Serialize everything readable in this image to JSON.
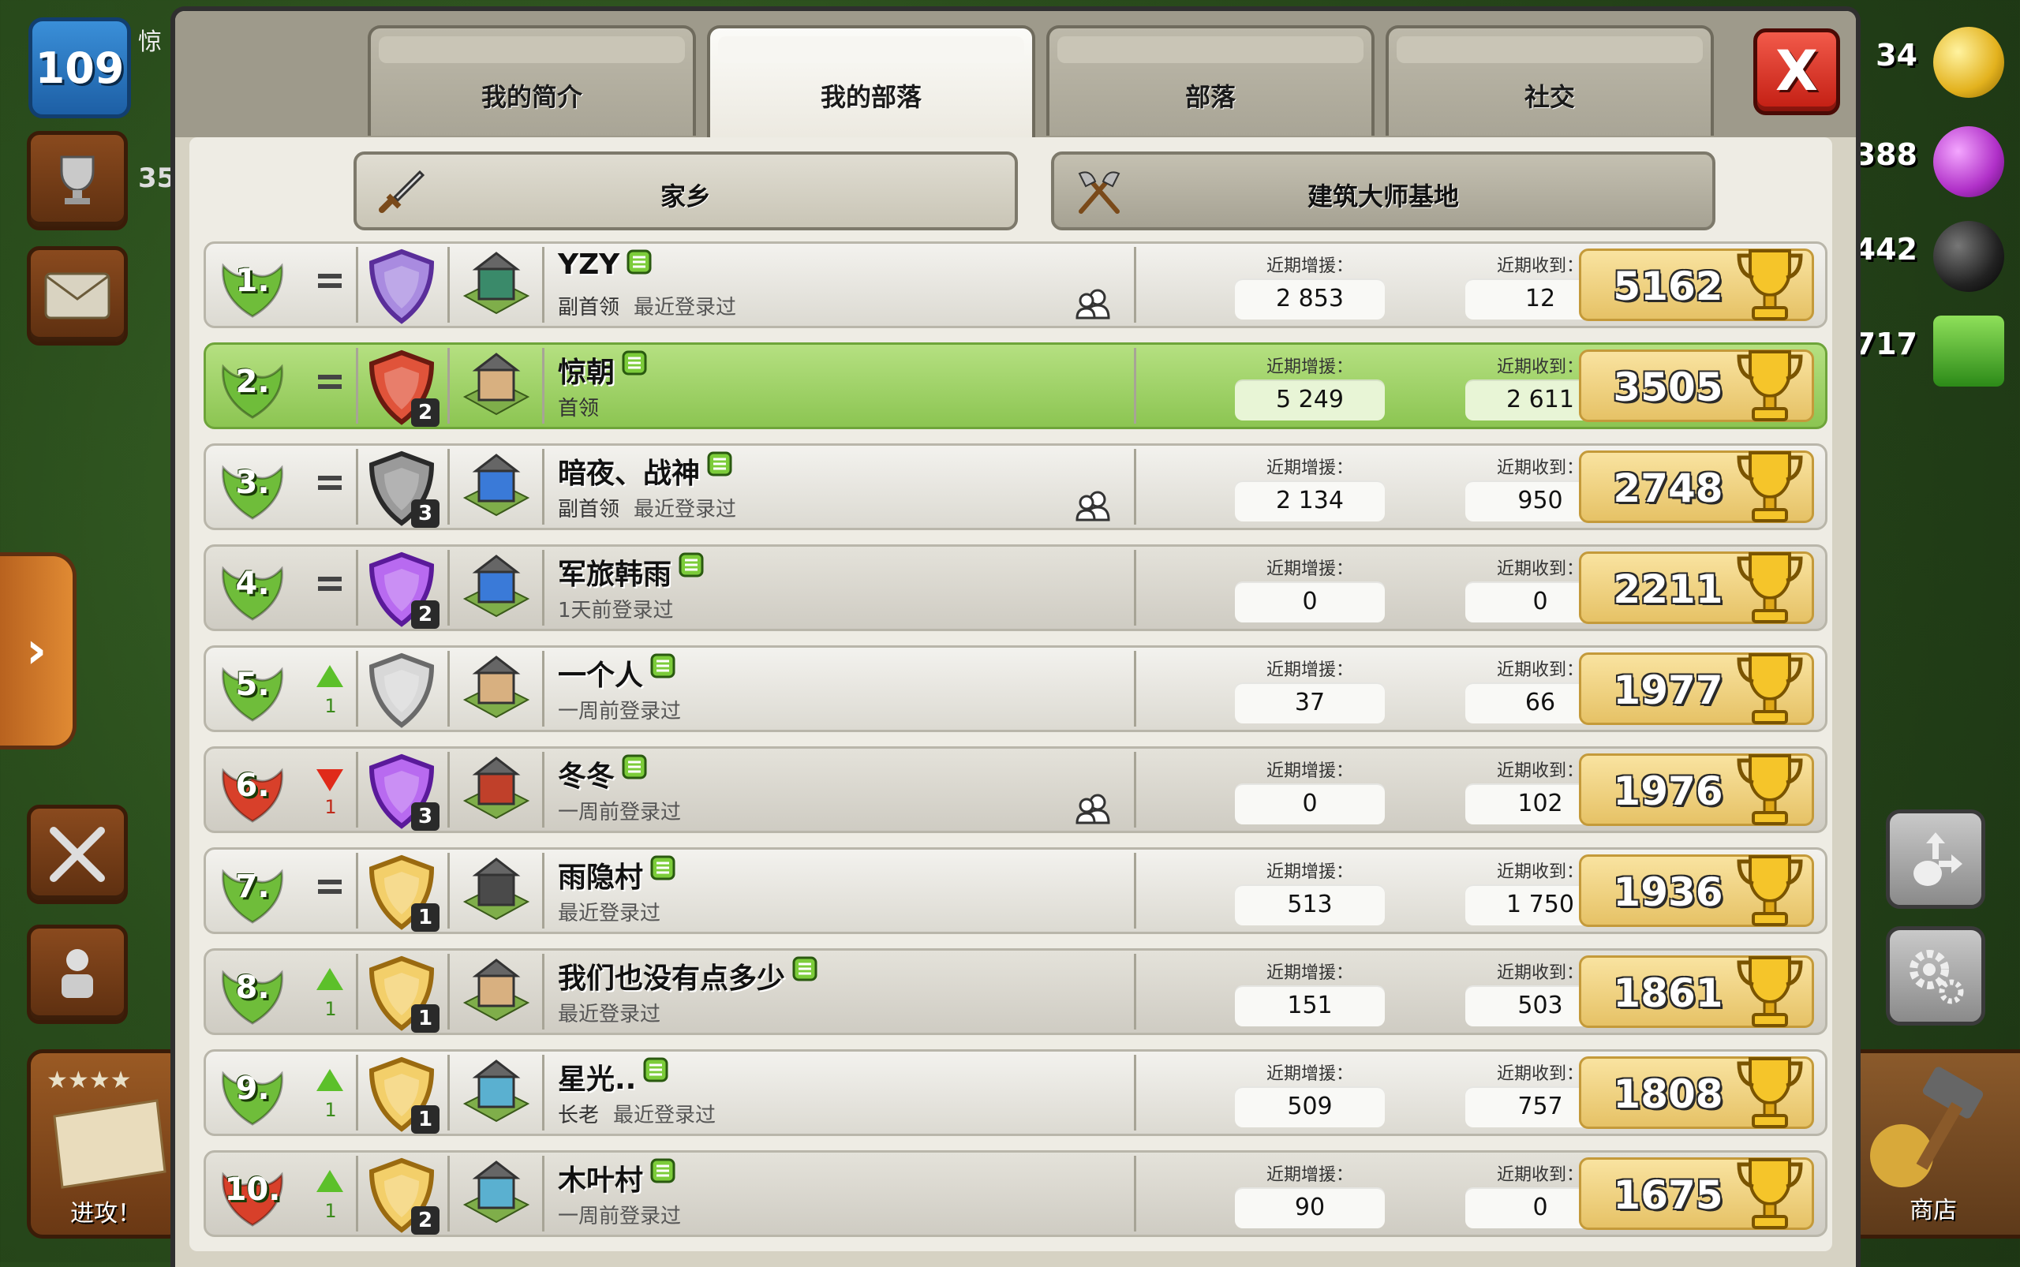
{
  "hud": {
    "level": "109",
    "player_name_fragment": "惊",
    "trophies_fragment": "35",
    "resources": {
      "gold": "34",
      "elixir": "388",
      "dark_elixir": "442",
      "gems": "717"
    },
    "attack_label": "进攻！",
    "shop_label": "商店",
    "side_tab_glyph": "›"
  },
  "tabs": [
    {
      "label": "我的简介",
      "active": false
    },
    {
      "label": "我的部落",
      "active": true
    },
    {
      "label": "部落",
      "active": false
    },
    {
      "label": "社交",
      "active": false
    }
  ],
  "close_label": "X",
  "subtabs": [
    {
      "label": "家乡",
      "icon": "sword-icon"
    },
    {
      "label": "建筑大师基地",
      "icon": "axes-icon"
    }
  ],
  "stat_labels": {
    "donated": "近期增援：",
    "received": "近期收到："
  },
  "colors": {
    "rank_green": "#6fbd3a",
    "rank_red": "#d8402a",
    "self_row": "#9fd462",
    "trophy_gold": "#f0cf6f"
  },
  "members": [
    {
      "rank": "1.",
      "change": "=",
      "league_level": "",
      "league": "crystal",
      "th": "th14",
      "name": "YZY",
      "role": "副首领",
      "last_seen": "最近登录过",
      "friend": true,
      "donated": "2 853",
      "received": "12",
      "trophies": "5162",
      "highlight": false,
      "rank_color": "green"
    },
    {
      "rank": "2.",
      "change": "=",
      "league_level": "2",
      "league": "titan",
      "th": "th11",
      "name": "惊朝",
      "role": "首领",
      "last_seen": "",
      "friend": false,
      "donated": "5 249",
      "received": "2 611",
      "trophies": "3505",
      "highlight": true,
      "rank_color": "green"
    },
    {
      "rank": "3.",
      "change": "=",
      "league_level": "3",
      "league": "master",
      "th": "th12",
      "name": "暗夜、战神",
      "role": "副首领",
      "last_seen": "最近登录过",
      "friend": true,
      "donated": "2 134",
      "received": "950",
      "trophies": "2748",
      "highlight": false,
      "rank_color": "green"
    },
    {
      "rank": "4.",
      "change": "=",
      "league_level": "2",
      "league": "amethyst",
      "th": "th12",
      "name": "军旅韩雨",
      "role": "",
      "last_seen": "1天前登录过",
      "friend": false,
      "donated": "0",
      "received": "0",
      "trophies": "2211",
      "highlight": false,
      "rank_color": "green"
    },
    {
      "rank": "5.",
      "change": "up",
      "delta": "1",
      "league_level": "",
      "league": "unranked",
      "th": "th11",
      "name": "一个人",
      "role": "",
      "last_seen": "一周前登录过",
      "friend": false,
      "donated": "37",
      "received": "66",
      "trophies": "1977",
      "highlight": false,
      "rank_color": "green"
    },
    {
      "rank": "6.",
      "change": "down",
      "delta": "1",
      "league_level": "3",
      "league": "amethyst",
      "th": "th10",
      "name": "冬冬",
      "role": "",
      "last_seen": "一周前登录过",
      "friend": true,
      "donated": "0",
      "received": "102",
      "trophies": "1976",
      "highlight": false,
      "rank_color": "red"
    },
    {
      "rank": "7.",
      "change": "=",
      "league_level": "1",
      "league": "gold",
      "th": "th9",
      "name": "雨隐村",
      "role": "",
      "last_seen": "最近登录过",
      "friend": false,
      "donated": "513",
      "received": "1 750",
      "trophies": "1936",
      "highlight": false,
      "rank_color": "green"
    },
    {
      "rank": "8.",
      "change": "up",
      "delta": "1",
      "league_level": "1",
      "league": "gold",
      "th": "th11",
      "name": "我们也没有点多少",
      "role": "",
      "last_seen": "最近登录过",
      "friend": false,
      "donated": "151",
      "received": "503",
      "trophies": "1861",
      "highlight": false,
      "rank_color": "green"
    },
    {
      "rank": "9.",
      "change": "up",
      "delta": "1",
      "league_level": "1",
      "league": "gold",
      "th": "th13",
      "name": "星光..",
      "role": "长老",
      "last_seen": "最近登录过",
      "friend": false,
      "donated": "509",
      "received": "757",
      "trophies": "1808",
      "highlight": false,
      "rank_color": "green"
    },
    {
      "rank": "10.",
      "change": "up",
      "delta": "1",
      "league_level": "2",
      "league": "gold",
      "th": "th13",
      "name": "木叶村",
      "role": "",
      "last_seen": "一周前登录过",
      "friend": false,
      "donated": "90",
      "received": "0",
      "trophies": "1675",
      "highlight": false,
      "rank_color": "red"
    }
  ]
}
